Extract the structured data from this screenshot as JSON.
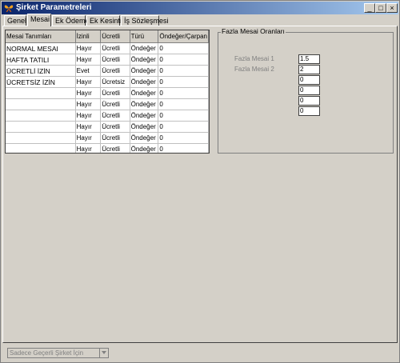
{
  "window": {
    "title": "Şirket Parametreleri"
  },
  "tabs": [
    {
      "label": "Genel"
    },
    {
      "label": "Mesai"
    },
    {
      "label": "Ek Ödeme"
    },
    {
      "label": "Ek Kesinti"
    },
    {
      "label": "İş Sözleşmesi"
    }
  ],
  "grid": {
    "headers": [
      "Mesai Tanımları",
      "İzinli",
      "Ücretli",
      "Türü",
      "Öndeğer/Çarpan"
    ],
    "rows": [
      [
        "NORMAL MESAI",
        "Hayır",
        "Ücretli",
        "Öndeğer",
        "0"
      ],
      [
        "HAFTA TATILI",
        "Hayır",
        "Ücretli",
        "Öndeğer",
        "0"
      ],
      [
        "ÜCRETLİ İZİN",
        "Evet",
        "Ücretli",
        "Öndeğer",
        "0"
      ],
      [
        "ÜCRETSİZ İZİN",
        "Hayır",
        "Ücretsiz",
        "Öndeğer",
        "0"
      ],
      [
        "",
        "Hayır",
        "Ücretli",
        "Öndeğer",
        "0"
      ],
      [
        "",
        "Hayır",
        "Ücretli",
        "Öndeğer",
        "0"
      ],
      [
        "",
        "Hayır",
        "Ücretli",
        "Öndeğer",
        "0"
      ],
      [
        "",
        "Hayır",
        "Ücretli",
        "Öndeğer",
        "0"
      ],
      [
        "",
        "Hayır",
        "Ücretli",
        "Öndeğer",
        "0"
      ],
      [
        "",
        "Hayır",
        "Ücretli",
        "Öndeğer",
        "0"
      ]
    ]
  },
  "overtime": {
    "title": "Fazla Mesai Oranları",
    "labels": [
      "Fazla Mesai 1",
      "Fazla Mesai 2"
    ],
    "values": [
      "1.5",
      "2",
      "0",
      "0",
      "0",
      "0"
    ]
  },
  "filter": {
    "value": "Sadece Geçerli Şirket İçin"
  },
  "icons": {
    "app": "butterfly-icon",
    "minimize": "minimize-icon",
    "maximize": "maximize-icon",
    "close": "close-icon",
    "dropdown": "chevron-down-icon"
  },
  "colors": {
    "titlebar_start": "#0a246a",
    "titlebar_end": "#a6caf0",
    "face": "#d4d0c8"
  }
}
